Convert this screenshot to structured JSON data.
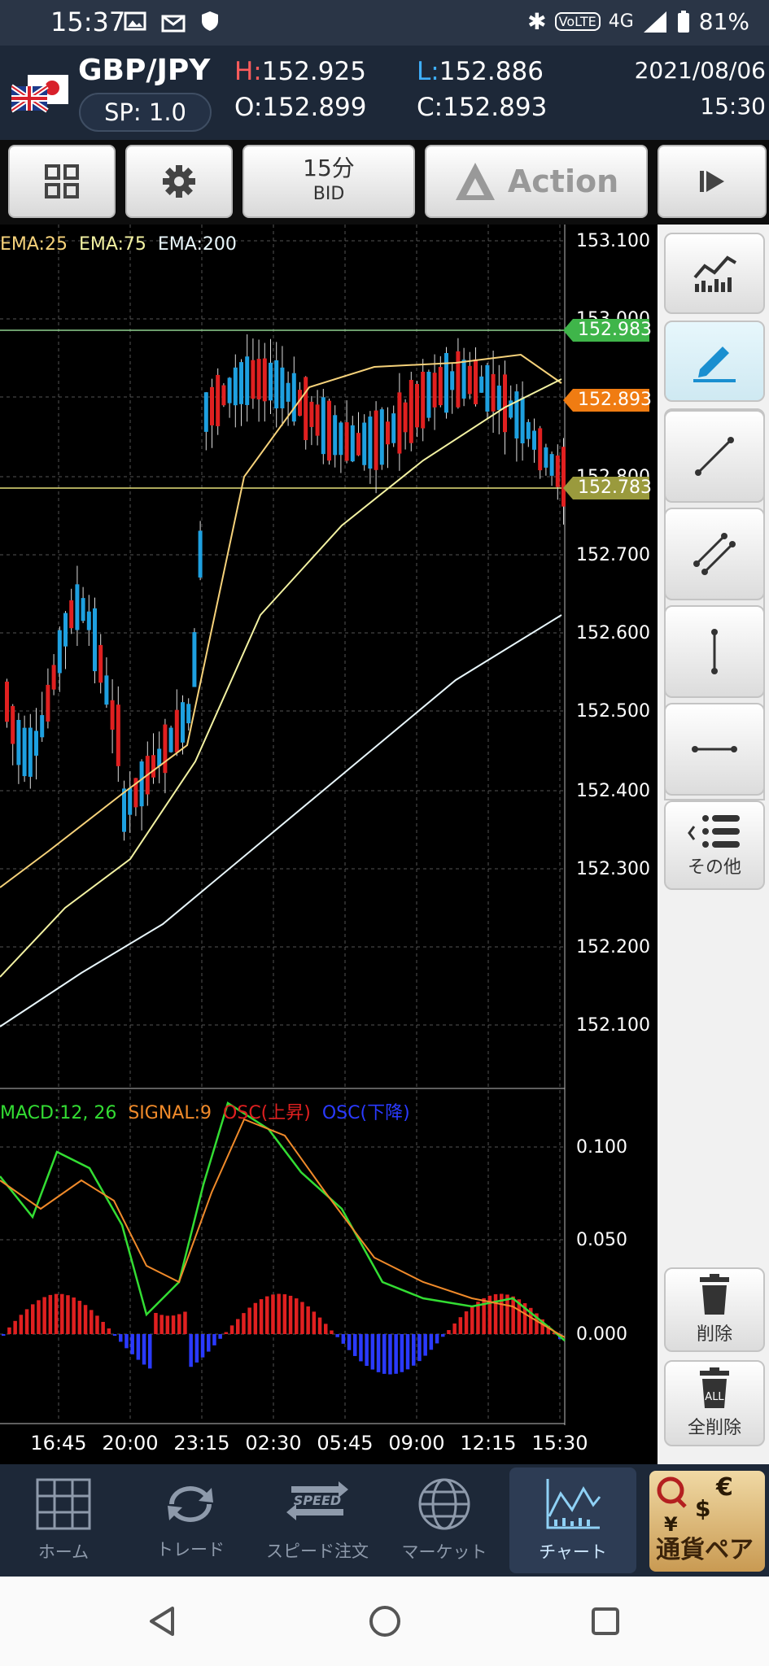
{
  "status": {
    "time": "15:37",
    "network": "4G",
    "battery": "81%"
  },
  "header": {
    "pair": "GBP/JPY",
    "spread": "SP: 1.0",
    "high_key": "H:",
    "high": "152.925",
    "low_key": "L:",
    "low": "152.886",
    "open_key": "O:",
    "open": "152.899",
    "close_key": "C:",
    "close": "152.893",
    "date": "2021/08/06",
    "time": "15:30"
  },
  "toolbar": {
    "timeframe": "15分",
    "price_type": "BID",
    "action": "Action"
  },
  "chart": {
    "ema_legend": [
      {
        "label": "EMA:25",
        "color": "#f6d27a"
      },
      {
        "label": "EMA:75",
        "color": "#f3f2a2"
      },
      {
        "label": "EMA:200",
        "color": "#e8f6fb"
      }
    ],
    "price_ticks": [
      "153.100",
      "153.000",
      "152.800",
      "152.700",
      "152.600",
      "152.500",
      "152.400",
      "152.300",
      "152.200",
      "152.100"
    ],
    "price_tags": [
      {
        "value": "152.983",
        "color": "#3fb54a"
      },
      {
        "value": "152.893",
        "color": "#f07c12"
      },
      {
        "value": "152.783",
        "color": "#9a9a3d"
      }
    ],
    "macd_legend": [
      {
        "label": "MACD:12, 26",
        "color": "#33dd33"
      },
      {
        "label": "SIGNAL:9",
        "color": "#f08a2a"
      },
      {
        "label": "OSC(上昇)",
        "color": "#e02020"
      },
      {
        "label": "OSC(下降)",
        "color": "#2a3aff"
      }
    ],
    "macd_ticks": [
      "0.100",
      "0.050",
      "0.000"
    ],
    "time_ticks": [
      "16:45",
      "20:00",
      "23:15",
      "02:30",
      "05:45",
      "09:00",
      "12:15",
      "15:30"
    ]
  },
  "side_tools": {
    "other": "その他",
    "delete": "削除",
    "delete_all": "全削除"
  },
  "nav": {
    "home": "ホーム",
    "trade": "トレード",
    "speed": "スピード注文",
    "market": "マーケット",
    "chart": "チャート",
    "pairs": "通貨ペア"
  },
  "colors": {
    "bull": "#e02020",
    "bear": "#1ea0e0",
    "accent": "#cfe9ff"
  },
  "chart_data": {
    "type": "line",
    "title": "GBP/JPY 15分 BID",
    "x": [
      "16:45",
      "20:00",
      "23:15",
      "02:30",
      "05:45",
      "09:00",
      "12:15",
      "15:30"
    ],
    "series": [
      {
        "name": "EMA:25",
        "values": [
          152.28,
          152.42,
          152.6,
          152.85,
          152.88,
          152.89,
          152.91,
          152.89
        ]
      },
      {
        "name": "EMA:75",
        "values": [
          152.22,
          152.3,
          152.44,
          152.62,
          152.7,
          152.75,
          152.78,
          152.81
        ]
      },
      {
        "name": "EMA:200",
        "values": [
          152.08,
          152.16,
          152.22,
          152.3,
          152.36,
          152.41,
          152.46,
          152.52
        ]
      },
      {
        "name": "MACD:12, 26",
        "values": [
          0.07,
          0.02,
          0.06,
          0.105,
          0.07,
          0.03,
          0.02,
          0.0
        ]
      },
      {
        "name": "SIGNAL:9",
        "values": [
          0.07,
          0.03,
          0.03,
          0.1,
          0.085,
          0.04,
          0.025,
          0.01
        ]
      }
    ],
    "ylim": [
      152.05,
      153.1
    ],
    "macd_ylim": [
      -0.04,
      0.12
    ]
  }
}
